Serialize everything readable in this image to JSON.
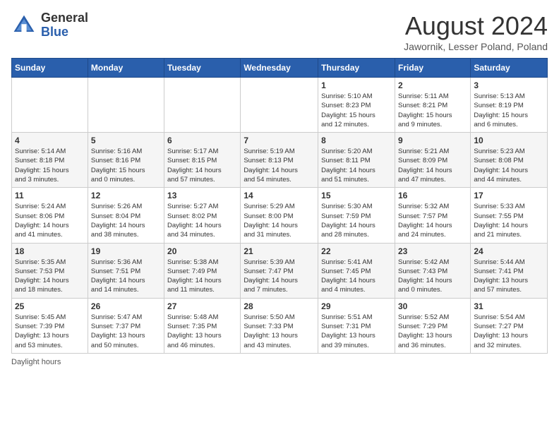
{
  "header": {
    "logo_general": "General",
    "logo_blue": "Blue",
    "month_title": "August 2024",
    "location": "Jawornik, Lesser Poland, Poland"
  },
  "days_of_week": [
    "Sunday",
    "Monday",
    "Tuesday",
    "Wednesday",
    "Thursday",
    "Friday",
    "Saturday"
  ],
  "weeks": [
    [
      {
        "day": "",
        "info": ""
      },
      {
        "day": "",
        "info": ""
      },
      {
        "day": "",
        "info": ""
      },
      {
        "day": "",
        "info": ""
      },
      {
        "day": "1",
        "info": "Sunrise: 5:10 AM\nSunset: 8:23 PM\nDaylight: 15 hours\nand 12 minutes."
      },
      {
        "day": "2",
        "info": "Sunrise: 5:11 AM\nSunset: 8:21 PM\nDaylight: 15 hours\nand 9 minutes."
      },
      {
        "day": "3",
        "info": "Sunrise: 5:13 AM\nSunset: 8:19 PM\nDaylight: 15 hours\nand 6 minutes."
      }
    ],
    [
      {
        "day": "4",
        "info": "Sunrise: 5:14 AM\nSunset: 8:18 PM\nDaylight: 15 hours\nand 3 minutes."
      },
      {
        "day": "5",
        "info": "Sunrise: 5:16 AM\nSunset: 8:16 PM\nDaylight: 15 hours\nand 0 minutes."
      },
      {
        "day": "6",
        "info": "Sunrise: 5:17 AM\nSunset: 8:15 PM\nDaylight: 14 hours\nand 57 minutes."
      },
      {
        "day": "7",
        "info": "Sunrise: 5:19 AM\nSunset: 8:13 PM\nDaylight: 14 hours\nand 54 minutes."
      },
      {
        "day": "8",
        "info": "Sunrise: 5:20 AM\nSunset: 8:11 PM\nDaylight: 14 hours\nand 51 minutes."
      },
      {
        "day": "9",
        "info": "Sunrise: 5:21 AM\nSunset: 8:09 PM\nDaylight: 14 hours\nand 47 minutes."
      },
      {
        "day": "10",
        "info": "Sunrise: 5:23 AM\nSunset: 8:08 PM\nDaylight: 14 hours\nand 44 minutes."
      }
    ],
    [
      {
        "day": "11",
        "info": "Sunrise: 5:24 AM\nSunset: 8:06 PM\nDaylight: 14 hours\nand 41 minutes."
      },
      {
        "day": "12",
        "info": "Sunrise: 5:26 AM\nSunset: 8:04 PM\nDaylight: 14 hours\nand 38 minutes."
      },
      {
        "day": "13",
        "info": "Sunrise: 5:27 AM\nSunset: 8:02 PM\nDaylight: 14 hours\nand 34 minutes."
      },
      {
        "day": "14",
        "info": "Sunrise: 5:29 AM\nSunset: 8:00 PM\nDaylight: 14 hours\nand 31 minutes."
      },
      {
        "day": "15",
        "info": "Sunrise: 5:30 AM\nSunset: 7:59 PM\nDaylight: 14 hours\nand 28 minutes."
      },
      {
        "day": "16",
        "info": "Sunrise: 5:32 AM\nSunset: 7:57 PM\nDaylight: 14 hours\nand 24 minutes."
      },
      {
        "day": "17",
        "info": "Sunrise: 5:33 AM\nSunset: 7:55 PM\nDaylight: 14 hours\nand 21 minutes."
      }
    ],
    [
      {
        "day": "18",
        "info": "Sunrise: 5:35 AM\nSunset: 7:53 PM\nDaylight: 14 hours\nand 18 minutes."
      },
      {
        "day": "19",
        "info": "Sunrise: 5:36 AM\nSunset: 7:51 PM\nDaylight: 14 hours\nand 14 minutes."
      },
      {
        "day": "20",
        "info": "Sunrise: 5:38 AM\nSunset: 7:49 PM\nDaylight: 14 hours\nand 11 minutes."
      },
      {
        "day": "21",
        "info": "Sunrise: 5:39 AM\nSunset: 7:47 PM\nDaylight: 14 hours\nand 7 minutes."
      },
      {
        "day": "22",
        "info": "Sunrise: 5:41 AM\nSunset: 7:45 PM\nDaylight: 14 hours\nand 4 minutes."
      },
      {
        "day": "23",
        "info": "Sunrise: 5:42 AM\nSunset: 7:43 PM\nDaylight: 14 hours\nand 0 minutes."
      },
      {
        "day": "24",
        "info": "Sunrise: 5:44 AM\nSunset: 7:41 PM\nDaylight: 13 hours\nand 57 minutes."
      }
    ],
    [
      {
        "day": "25",
        "info": "Sunrise: 5:45 AM\nSunset: 7:39 PM\nDaylight: 13 hours\nand 53 minutes."
      },
      {
        "day": "26",
        "info": "Sunrise: 5:47 AM\nSunset: 7:37 PM\nDaylight: 13 hours\nand 50 minutes."
      },
      {
        "day": "27",
        "info": "Sunrise: 5:48 AM\nSunset: 7:35 PM\nDaylight: 13 hours\nand 46 minutes."
      },
      {
        "day": "28",
        "info": "Sunrise: 5:50 AM\nSunset: 7:33 PM\nDaylight: 13 hours\nand 43 minutes."
      },
      {
        "day": "29",
        "info": "Sunrise: 5:51 AM\nSunset: 7:31 PM\nDaylight: 13 hours\nand 39 minutes."
      },
      {
        "day": "30",
        "info": "Sunrise: 5:52 AM\nSunset: 7:29 PM\nDaylight: 13 hours\nand 36 minutes."
      },
      {
        "day": "31",
        "info": "Sunrise: 5:54 AM\nSunset: 7:27 PM\nDaylight: 13 hours\nand 32 minutes."
      }
    ]
  ],
  "footer": {
    "note": "Daylight hours"
  }
}
